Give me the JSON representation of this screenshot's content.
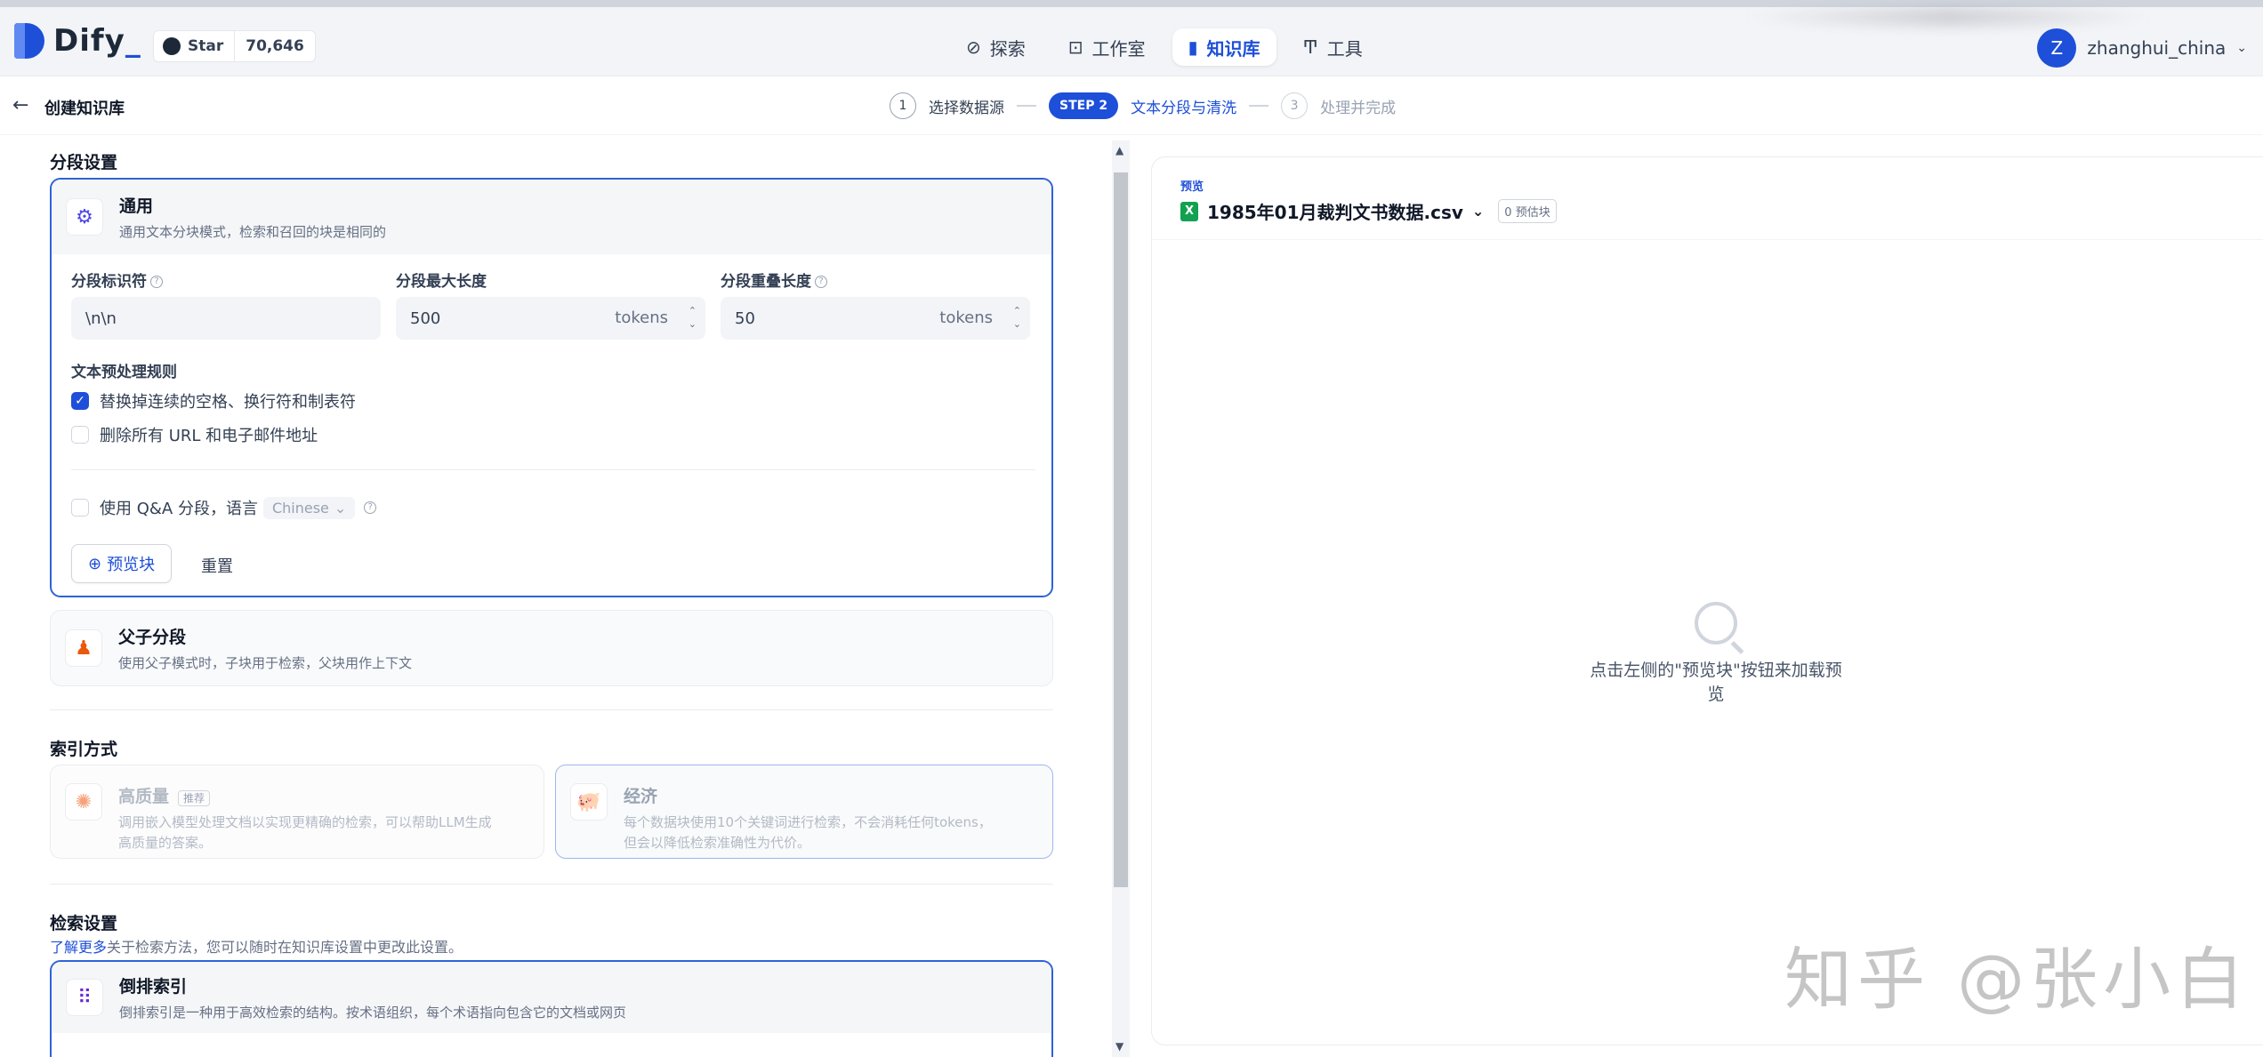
{
  "app": {
    "name": "Dify"
  },
  "github": {
    "star_label": "Star",
    "star_count": "70,646"
  },
  "nav": [
    {
      "label": "探索",
      "icon": "explore-icon"
    },
    {
      "label": "工作室",
      "icon": "robot-icon"
    },
    {
      "label": "知识库",
      "icon": "book-icon",
      "active": true
    },
    {
      "label": "工具",
      "icon": "tool-icon"
    }
  ],
  "user": {
    "initial": "Z",
    "name": "zhanghui_china"
  },
  "page": {
    "title": "创建知识库"
  },
  "steps": [
    {
      "num": "1",
      "label": "选择数据源"
    },
    {
      "badge": "STEP 2",
      "label": "文本分段与清洗",
      "active": true
    },
    {
      "num": "3",
      "label": "处理并完成"
    }
  ],
  "segment": {
    "section_title": "分段设置",
    "general": {
      "title": "通用",
      "desc": "通用文本分块模式，检索和召回的块是相同的",
      "delimiter_label": "分段标识符",
      "delimiter_value": "\\n\\n",
      "max_len_label": "分段最大长度",
      "max_len_value": "500",
      "overlap_label": "分段重叠长度",
      "overlap_value": "50",
      "unit": "tokens",
      "rules_title": "文本预处理规则",
      "rule1": "替换掉连续的空格、换行符和制表符",
      "rule1_checked": true,
      "rule2": "删除所有 URL 和电子邮件地址",
      "rule2_checked": false,
      "qa_label": "使用 Q&A 分段，语言",
      "qa_lang": "Chinese",
      "preview_btn": "预览块",
      "reset_btn": "重置"
    },
    "parent_child": {
      "title": "父子分段",
      "desc": "使用父子模式时，子块用于检索，父块用作上下文"
    }
  },
  "index": {
    "section_title": "索引方式",
    "high": {
      "title": "高质量",
      "badge": "推荐",
      "desc1": "调用嵌入模型处理文档以实现更精确的检索，可以帮助LLM生成",
      "desc2": "高质量的答案。"
    },
    "eco": {
      "title": "经济",
      "desc1": "每个数据块使用10个关键词进行检索，不会消耗任何tokens，",
      "desc2": "但会以降低检索准确性为代价。"
    }
  },
  "retrieval": {
    "section_title": "检索设置",
    "link": "了解更多",
    "hint": "关于检索方法，您可以随时在知识库设置中更改此设置。",
    "inverted": {
      "title": "倒排索引",
      "desc": "倒排索引是一种用于高效检索的结构。按术语组织，每个术语指向包含它的文档或网页"
    }
  },
  "preview": {
    "label": "预览",
    "file": "1985年01月裁判文书数据.csv",
    "chunks": "0 预估块",
    "empty_hint": "点击左侧的\"预览块\"按钮来加载预览"
  },
  "watermark": "知乎 @张小白",
  "colors": {
    "accent": "#1e4fd8",
    "border_selected": "#2e62d8"
  }
}
